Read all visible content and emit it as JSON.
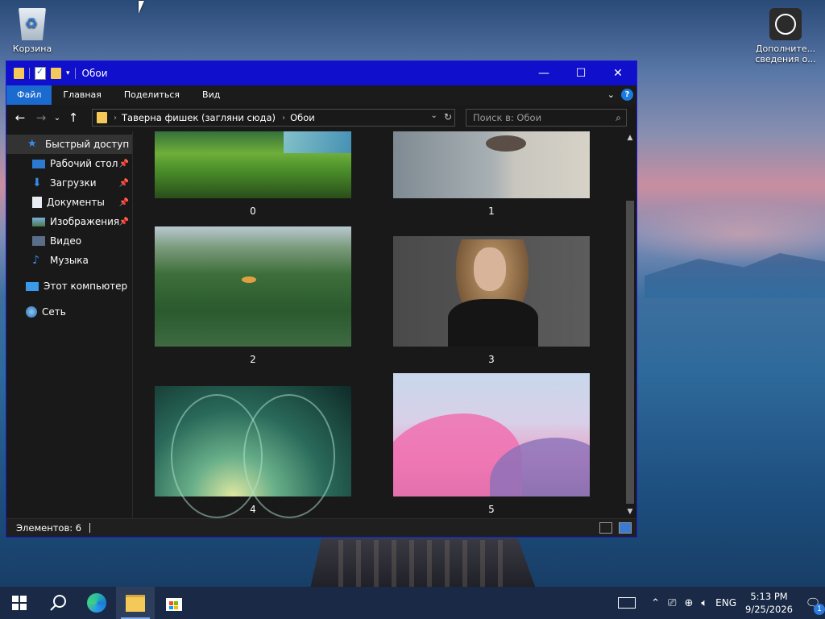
{
  "desktop": {
    "recycle_bin_label": "Корзина",
    "add_info_label_line1": "Дополните...",
    "add_info_label_line2": "сведения о..."
  },
  "window": {
    "title": "Обои",
    "controls": {
      "minimize": "—",
      "maximize": "☐",
      "close": "✕"
    }
  },
  "ribbon": {
    "tabs": [
      "Файл",
      "Главная",
      "Поделиться",
      "Вид"
    ],
    "help": "?"
  },
  "navigation": {
    "address_parts": [
      "Таверна фишек (загляни сюда)",
      "Обои"
    ],
    "search_placeholder": "Поиск в: Обои"
  },
  "sidebar": {
    "items": [
      {
        "label": "Быстрый доступ",
        "icon": "star-icon",
        "pinned": false,
        "selected": true
      },
      {
        "label": "Рабочий стол",
        "icon": "desktop-icon",
        "pinned": true
      },
      {
        "label": "Загрузки",
        "icon": "download-icon",
        "pinned": true
      },
      {
        "label": "Документы",
        "icon": "documents-icon",
        "pinned": true
      },
      {
        "label": "Изображения",
        "icon": "pictures-icon",
        "pinned": true
      },
      {
        "label": "Видео",
        "icon": "video-icon",
        "pinned": false
      },
      {
        "label": "Музыка",
        "icon": "music-icon",
        "pinned": false
      },
      {
        "label": "Этот компьютер",
        "icon": "computer-icon",
        "pinned": false
      },
      {
        "label": "Сеть",
        "icon": "network-icon",
        "pinned": false
      }
    ]
  },
  "files": [
    {
      "name": "0"
    },
    {
      "name": "1"
    },
    {
      "name": "2"
    },
    {
      "name": "3"
    },
    {
      "name": "4"
    },
    {
      "name": "5"
    }
  ],
  "status": {
    "items_count": "Элементов: 6"
  },
  "taskbar": {
    "language": "ENG",
    "time": "5:13 PM",
    "date": "9/25/2026",
    "notification_count": "1"
  }
}
